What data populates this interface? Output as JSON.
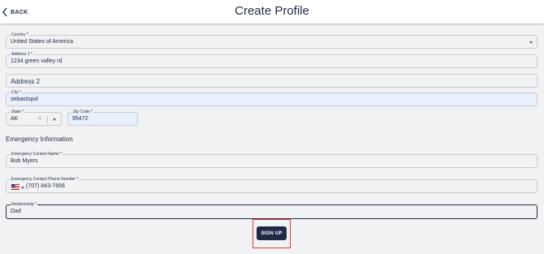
{
  "header": {
    "back_label": "BACK",
    "title": "Create Profile"
  },
  "address": {
    "country": {
      "label": "Country *",
      "value": "United States of America"
    },
    "address1": {
      "label": "Address 1 *",
      "value": "1234 green valley rd"
    },
    "address2": {
      "placeholder": "Address 2"
    },
    "city": {
      "label": "City *",
      "value": "sebastopol"
    },
    "state": {
      "label": "State *",
      "value": "AK"
    },
    "zip": {
      "label": "Zip Code *",
      "value": "95472"
    }
  },
  "emergency": {
    "section_title": "Emergency Information",
    "contact_name": {
      "label": "Emergency Contact Name *",
      "value": "Bob Myers"
    },
    "contact_phone": {
      "label": "Emergency Contact Phone Number *",
      "value": "(707) 843-7856",
      "flag_icon": "us-flag-icon"
    },
    "relationship": {
      "label": "Relationship *",
      "value": "Dad"
    }
  },
  "actions": {
    "signup_label": "SIGN UP"
  },
  "colors": {
    "primary": "#1f2a44",
    "highlight_field": "#e8f0fe",
    "annotation_red": "#e53935",
    "background": "#f1f2f3"
  }
}
